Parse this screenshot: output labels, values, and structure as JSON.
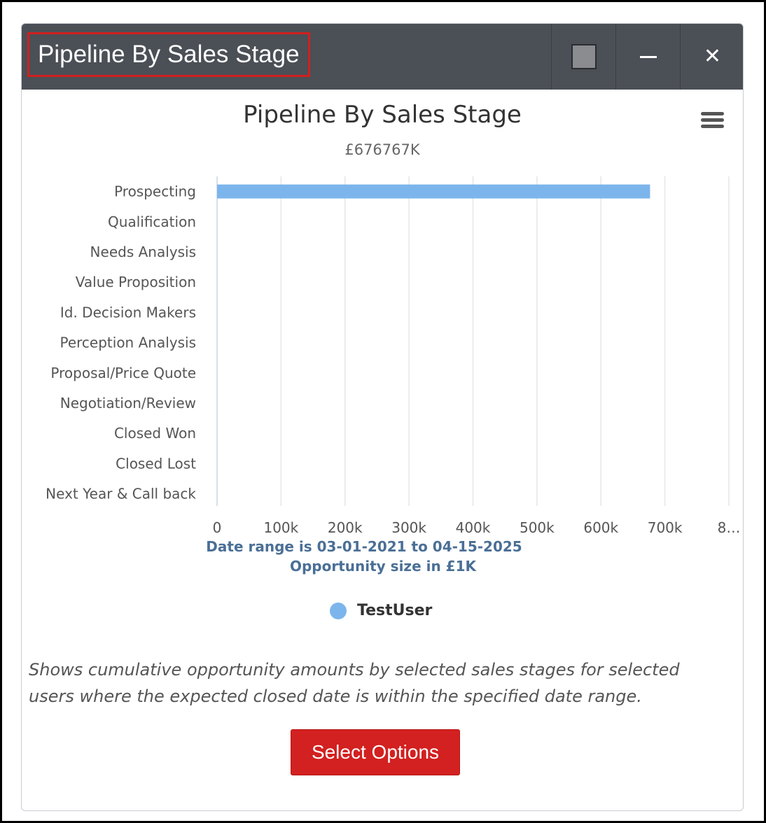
{
  "dashlet": {
    "title": "Pipeline By Sales Stage",
    "toolbar_icons": [
      "square-icon",
      "minimize-icon",
      "close-icon"
    ],
    "description": "Shows cumulative opportunity amounts by selected sales stages for selected users where the expected closed date is within the specified date range.",
    "select_options_label": "Select Options",
    "accent_color": "#d32020",
    "titlebar_color": "#4b4f56"
  },
  "chart_data": {
    "type": "bar",
    "orientation": "horizontal",
    "title": "Pipeline By Sales Stage",
    "subtitle": "£676767K",
    "categories": [
      "Prospecting",
      "Qualification",
      "Needs Analysis",
      "Value Proposition",
      "Id. Decision Makers",
      "Perception Analysis",
      "Proposal/Price Quote",
      "Negotiation/Review",
      "Closed Won",
      "Closed Lost",
      "Next Year & Call back"
    ],
    "series": [
      {
        "name": "TestUser",
        "color": "#7cb5ec",
        "values": [
          676767,
          0,
          0,
          0,
          0,
          0,
          0,
          0,
          0,
          0,
          0
        ]
      }
    ],
    "xlim": [
      0,
      800000
    ],
    "x_ticks": [
      "0",
      "100k",
      "200k",
      "300k",
      "400k",
      "500k",
      "600k",
      "700k",
      "8…"
    ],
    "xlabel_lines": [
      "Date range is 03-01-2021 to 04-15-2025",
      "Opportunity size in £1K"
    ],
    "grid": true,
    "legend_position": "bottom"
  }
}
